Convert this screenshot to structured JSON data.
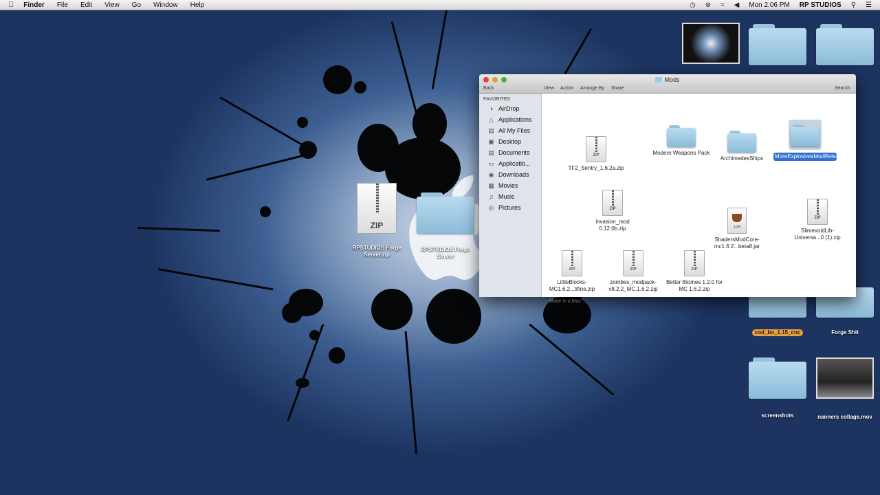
{
  "menubar": {
    "app_name": "Finder",
    "menus": [
      "File",
      "Edit",
      "View",
      "Go",
      "Window",
      "Help"
    ],
    "clock": "Mon 2:06 PM",
    "user": "RP STUDIOS"
  },
  "desktop": {
    "center_items": [
      {
        "label": "RPSTUDIOS Forge Server.zip",
        "icon": "zip-archive-icon",
        "badge": "ZIP"
      },
      {
        "label": "RPSTUDIOS Forge Server",
        "icon": "folder-icon"
      }
    ],
    "right_items": [
      {
        "label": "",
        "icon": "video-thumbnail-icon"
      },
      {
        "label": "",
        "icon": "folder-icon"
      },
      {
        "label": "",
        "icon": "folder-icon"
      },
      {
        "label": "cod_bo_1.15_cnc",
        "icon": "folder-icon",
        "tagged": true
      },
      {
        "label": "Forge Shit",
        "icon": "folder-icon"
      },
      {
        "label": "screenshots",
        "icon": "folder-icon"
      },
      {
        "label": "nanners collage.mov",
        "icon": "video-thumbnail-icon"
      }
    ]
  },
  "finder": {
    "title": "Mods",
    "toolbar": {
      "back": "Back",
      "view": "View",
      "action": "Action",
      "arrange": "Arrange By",
      "share": "Share",
      "search": "Search"
    },
    "sidebar": {
      "header": "FAVORITES",
      "items": [
        {
          "label": "AirDrop",
          "icon": "airdrop-icon"
        },
        {
          "label": "Applications",
          "icon": "applications-icon"
        },
        {
          "label": "All My Files",
          "icon": "all-files-icon"
        },
        {
          "label": "Desktop",
          "icon": "desktop-icon"
        },
        {
          "label": "Documents",
          "icon": "documents-icon"
        },
        {
          "label": "Applicatio...",
          "icon": "folder-icon"
        },
        {
          "label": "Downloads",
          "icon": "downloads-icon"
        },
        {
          "label": "Movies",
          "icon": "movies-icon"
        },
        {
          "label": "Music",
          "icon": "music-icon"
        },
        {
          "label": "Pictures",
          "icon": "pictures-icon"
        }
      ]
    },
    "files": [
      {
        "name": "TF2_Sentry_1.6.2a.zip",
        "icon": "zip-file-icon",
        "badge": "ZIP"
      },
      {
        "name": "Modern Weapons Pack",
        "icon": "folder-icon"
      },
      {
        "name": "ArchimedesShips",
        "icon": "folder-icon"
      },
      {
        "name": "MoreExplosivesModReleas...craft1.6.2",
        "icon": "folder-icon",
        "selected": true
      },
      {
        "name": "invasion_mod 0.12.0b.zip",
        "icon": "zip-file-icon",
        "badge": "ZIP"
      },
      {
        "name": "ShadersModCore-mc1.6.2...beta8.jar",
        "icon": "jar-file-icon",
        "badge": "JAR"
      },
      {
        "name": "SlimevoidLib-Universa...0 (1).zip",
        "icon": "zip-file-icon",
        "badge": "ZIP"
      },
      {
        "name": "LittleBlocks-MC1.6.2...tifine.zip",
        "icon": "zip-file-icon",
        "badge": "ZIP"
      },
      {
        "name": "zombes_modpack-v8.2.2_MC.1.6.2.zip",
        "icon": "zip-file-icon",
        "badge": "ZIP"
      },
      {
        "name": "Better Biomes 1.2.0 for MC 1.6.2.zip",
        "icon": "zip-file-icon",
        "badge": "ZIP"
      }
    ],
    "footer_hint": "Made in a Mac"
  },
  "colors": {
    "selection": "#3470d0",
    "folder": "#9fcbe6",
    "desktop_dark": "#1d3461"
  }
}
